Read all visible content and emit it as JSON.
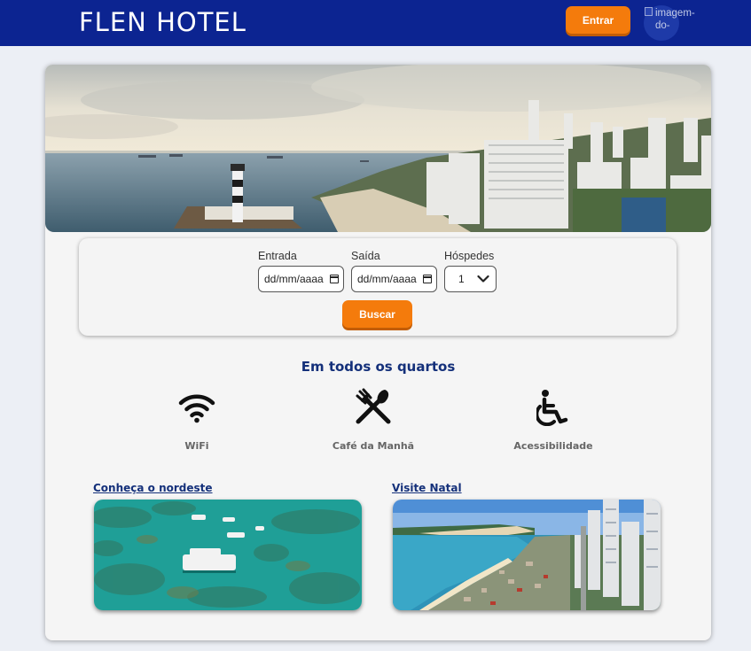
{
  "header": {
    "brand": "FLEN HOTEL",
    "login_label": "Entrar",
    "avatar_alt": "imagem-do-"
  },
  "search": {
    "checkin_label": "Entrada",
    "checkin_placeholder": "dd/mm/aaaa",
    "checkout_label": "Saída",
    "checkout_placeholder": "dd/mm/aaaa",
    "guests_label": "Hóspedes",
    "guests_value": "1",
    "search_label": "Buscar"
  },
  "amenities": {
    "title": "Em todos os quartos",
    "items": [
      {
        "label": "WiFi",
        "icon": "wifi-icon"
      },
      {
        "label": "Café da Manhã",
        "icon": "utensils-icon"
      },
      {
        "label": "Acessibilidade",
        "icon": "wheelchair-icon"
      }
    ]
  },
  "promos": [
    {
      "title": "Conheça o nordeste"
    },
    {
      "title": "Visite Natal"
    }
  ],
  "colors": {
    "header_bg": "#0c2491",
    "accent": "#f47b0c",
    "title_blue": "#14307a"
  }
}
